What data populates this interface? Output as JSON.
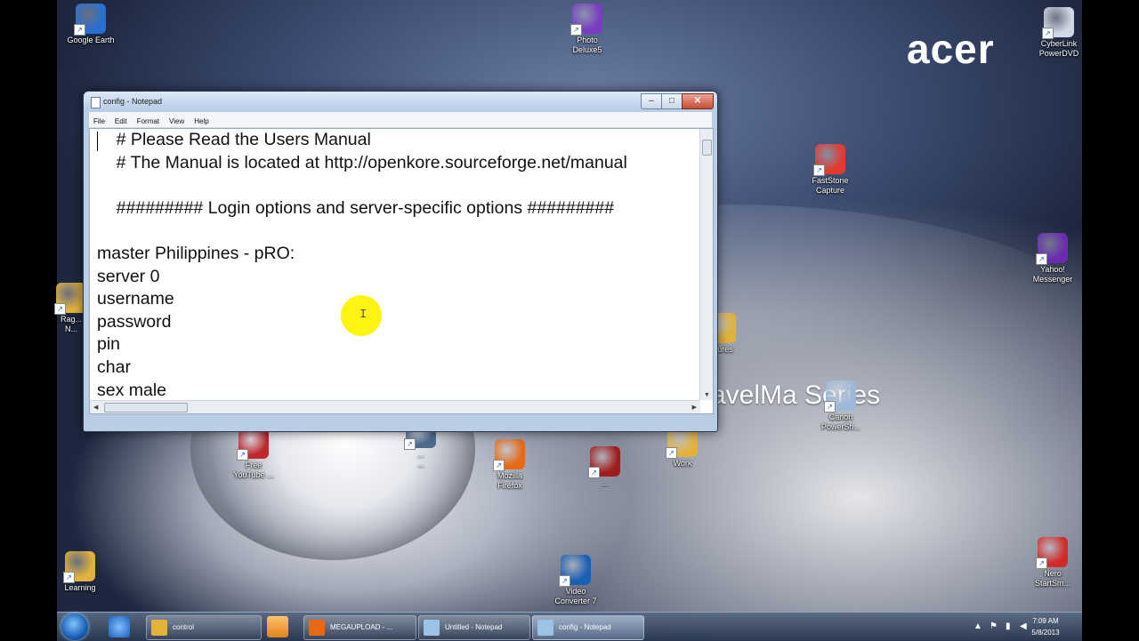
{
  "desktop": {
    "brand": "acer",
    "series_text": "avelMa  Series",
    "icons": [
      {
        "name": "google-earth-icon",
        "label": "Google Earth",
        "color": "#2a6fd0"
      },
      {
        "name": "photo-app-icon",
        "label": "Photo\nDeluxe5",
        "color": "#7a3cc0"
      },
      {
        "name": "cyberlink-powerdvd-icon",
        "label": "CyberLink\nPowerDVD",
        "color": "#cfd8e4"
      },
      {
        "name": "flash-app-icon",
        "label": "FastStone\nCapture",
        "color": "#e23a2e"
      },
      {
        "name": "yahoo-messenger-icon",
        "label": "Yahoo!\nMessenger",
        "color": "#6a2bb0"
      },
      {
        "name": "folder-icon",
        "label": "Rag...\nN...",
        "color": "#e3b23c"
      },
      {
        "name": "folder-pictures-icon",
        "label": "...tures",
        "color": "#e3b23c"
      },
      {
        "name": "canon-app-icon",
        "label": "Canon\nPowerSh...",
        "color": "#9db8d8"
      },
      {
        "name": "youtube-downloader-icon",
        "label": "Free\nYouTube ...",
        "color": "#c1272d"
      },
      {
        "name": "aviary-icon",
        "label": "...\n...",
        "color": "#4f6a8f"
      },
      {
        "name": "firefox-icon",
        "label": "Mozilla\nFirefox",
        "color": "#e66a16"
      },
      {
        "name": "game-shortcut-icon",
        "label": "...",
        "color": "#a01b1b"
      },
      {
        "name": "work-folder-icon",
        "label": "Work",
        "color": "#e3b23c"
      },
      {
        "name": "learning-folder-icon",
        "label": "Learning",
        "color": "#e3b23c"
      },
      {
        "name": "video-app-icon",
        "label": "Video\nConverter 7",
        "color": "#1a5fb4"
      },
      {
        "name": "nero-app-icon",
        "label": "Nero\nStartSm...",
        "color": "#d02a2a"
      }
    ]
  },
  "notepad": {
    "title": "config - Notepad",
    "menu": [
      "File",
      "Edit",
      "Format",
      "View",
      "Help"
    ],
    "lines": [
      "    # Please Read the Users Manual",
      "    # The Manual is located at http://openkore.sourceforge.net/manual",
      "",
      "    ######### Login options and server-specific options #########",
      "",
      "master Philippines - pRO:",
      "server 0",
      "username",
      "password",
      "pin",
      "char",
      "sex male"
    ],
    "buttons": {
      "minimize": "–",
      "maximize": "□",
      "close": "✕"
    }
  },
  "taskbar": {
    "items": [
      {
        "label": "control",
        "color": "#e3b23c",
        "active": false
      },
      {
        "label": "MEGAUPLOAD - ...",
        "color": "#e66a16",
        "active": false
      },
      {
        "label": "Untitled - Notepad",
        "color": "#9cc3e6",
        "active": false
      },
      {
        "label": "config - Notepad",
        "color": "#9cc3e6",
        "active": true
      }
    ],
    "clock_time": "7:09 AM",
    "clock_date": "5/8/2013"
  }
}
